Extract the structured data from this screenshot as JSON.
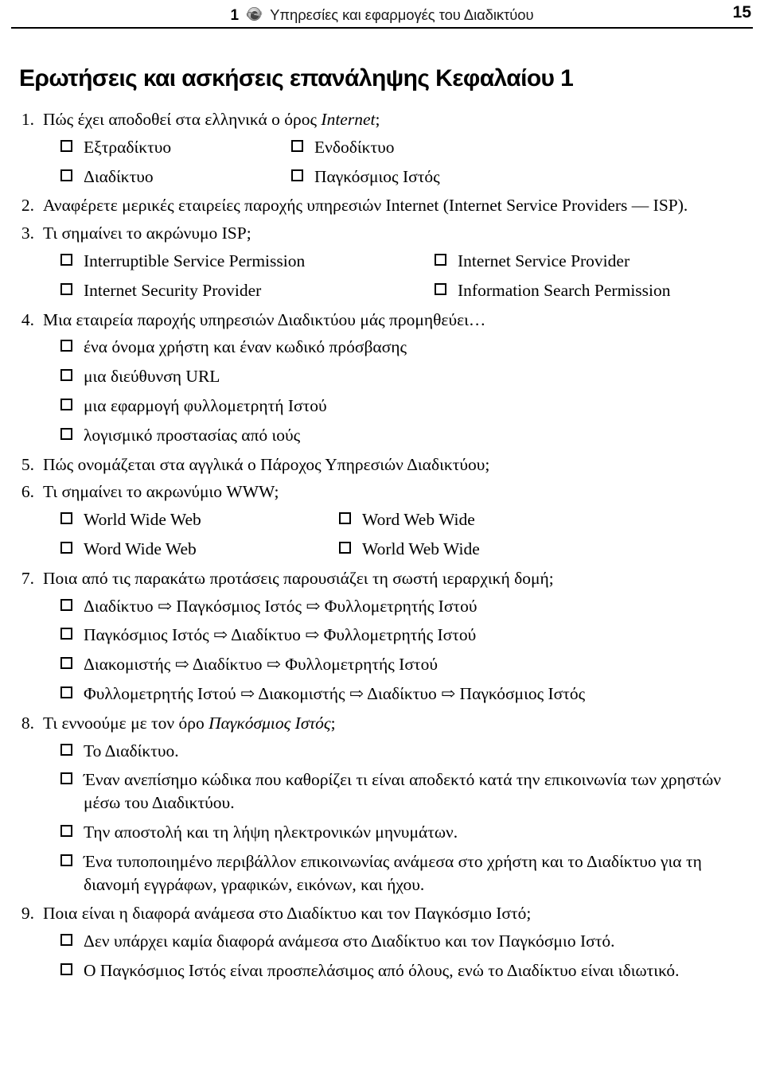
{
  "header": {
    "chapter_number": "1",
    "icon": "internet-explorer-icon",
    "title": "Υπηρεσίες και εφαρμογές του Διαδικτύου",
    "page_number": "15"
  },
  "section": {
    "title": "Ερωτήσεις και ασκήσεις επανάληψης Κεφαλαίου 1"
  },
  "questions": [
    {
      "number": "1.",
      "text_before_italic": "Πώς έχει αποδοθεί στα ελληνικά ο όρος ",
      "text_italic": "Internet",
      "text_after_italic": ";",
      "options_layout": "two-column",
      "options": [
        "Εξτραδίκτυο",
        "Ενδοδίκτυο",
        "Διαδίκτυο",
        "Παγκόσμιος Ιστός"
      ]
    },
    {
      "number": "2.",
      "text": "Αναφέρετε μερικές εταιρείες παροχής υπηρεσιών Internet (Internet Service Providers — ISP).",
      "options_layout": "none",
      "options": []
    },
    {
      "number": "3.",
      "text": "Τι σημαίνει το ακρώνυμο ISP;",
      "options_layout": "two-column",
      "options": [
        "Interruptible Service Permission",
        "Internet Service Provider",
        "Internet Security Provider",
        "Information Search Permission"
      ]
    },
    {
      "number": "4.",
      "text": "Μια εταιρεία παροχής υπηρεσιών Διαδικτύου μάς προμηθεύει…",
      "options_layout": "single-column",
      "options": [
        "ένα όνομα χρήστη και έναν κωδικό πρόσβασης",
        "μια διεύθυνση URL",
        "μια εφαρμογή φυλλομετρητή Ιστού",
        "λογισμικό προστασίας από ιούς"
      ]
    },
    {
      "number": "5.",
      "text": "Πώς ονομάζεται στα αγγλικά ο Πάροχος Υπηρεσιών Διαδικτύου;",
      "options_layout": "none",
      "options": []
    },
    {
      "number": "6.",
      "text": "Τι σημαίνει το ακρωνύμιο WWW;",
      "options_layout": "two-column",
      "options": [
        "World Wide Web",
        "Word Web Wide",
        "Word Wide Web",
        "World Web Wide"
      ]
    },
    {
      "number": "7.",
      "text": "Ποια από τις παρακάτω προτάσεις παρουσιάζει τη σωστή ιεραρχική δομή;",
      "options_layout": "single-column",
      "options": [
        "Διαδίκτυο ⇨ Παγκόσμιος Ιστός ⇨ Φυλλομετρητής Ιστού",
        "Παγκόσμιος Ιστός ⇨ Διαδίκτυο ⇨ Φυλλομετρητής Ιστού",
        "Διακομιστής ⇨ Διαδίκτυο ⇨ Φυλλομετρητής Ιστού",
        "Φυλλομετρητής Ιστού ⇨ Διακομιστής ⇨ Διαδίκτυο ⇨ Παγκόσμιος Ιστός"
      ]
    },
    {
      "number": "8.",
      "text_before_italic": "Τι εννοούμε με τον όρο ",
      "text_italic": "Παγκόσμιος Ιστός",
      "text_after_italic": ";",
      "options_layout": "single-column",
      "options": [
        "Το Διαδίκτυο.",
        "Έναν ανεπίσημο κώδικα που καθορίζει τι είναι αποδεκτό κατά την επικοινωνία των χρηστών μέσω του Διαδικτύου.",
        "Την αποστολή και τη λήψη ηλεκτρονικών μηνυμάτων.",
        "Ένα τυποποιημένο περιβάλλον επικοινωνίας ανάμεσα στο χρήστη και το Διαδίκτυο για τη διανομή εγγράφων, γραφικών, εικόνων, και ήχου."
      ]
    },
    {
      "number": "9.",
      "text": "Ποια είναι η διαφορά ανάμεσα στο Διαδίκτυο και τον Παγκόσμιο Ιστό;",
      "options_layout": "single-column",
      "options": [
        "Δεν υπάρχει καμία διαφορά ανάμεσα στο Διαδίκτυο και τον Παγκόσμιο Ιστό.",
        "Ο Παγκόσμιος Ιστός είναι προσπελάσιμος από όλους, ενώ το Διαδίκτυο είναι ιδιωτικό."
      ]
    }
  ]
}
